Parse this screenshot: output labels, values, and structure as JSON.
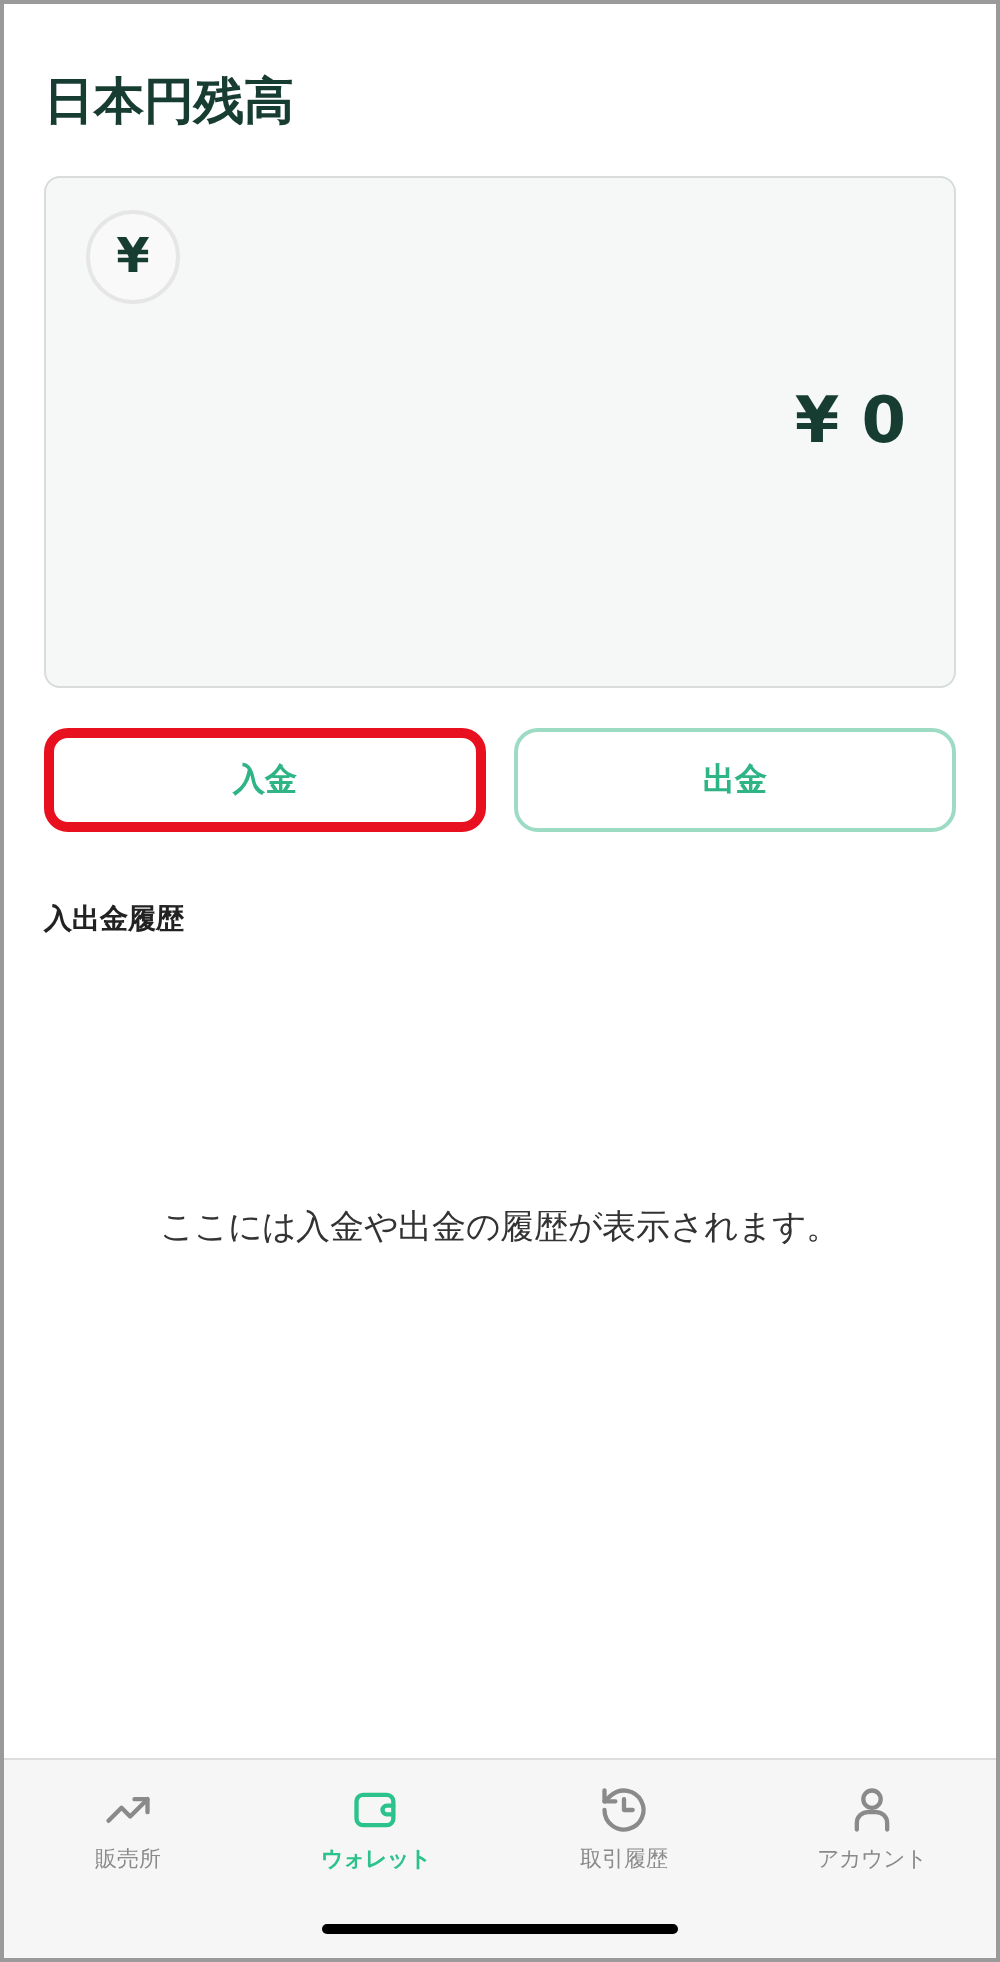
{
  "title": "日本円残高",
  "balance": {
    "currency_symbol": "¥",
    "amount": "¥ 0"
  },
  "actions": [
    {
      "label": "入金",
      "highlighted": true
    },
    {
      "label": "出金",
      "highlighted": false
    }
  ],
  "history": {
    "heading": "入出金履歴",
    "empty_message": "ここには入金や出金の履歴が表示されます。"
  },
  "tabs": [
    {
      "label": "販売所",
      "kind": "chart",
      "selected": false
    },
    {
      "label": "ウォレット",
      "kind": "wallet",
      "selected": true
    },
    {
      "label": "取引履歴",
      "kind": "history",
      "selected": false
    },
    {
      "label": "アカウント",
      "kind": "account",
      "selected": false
    }
  ]
}
